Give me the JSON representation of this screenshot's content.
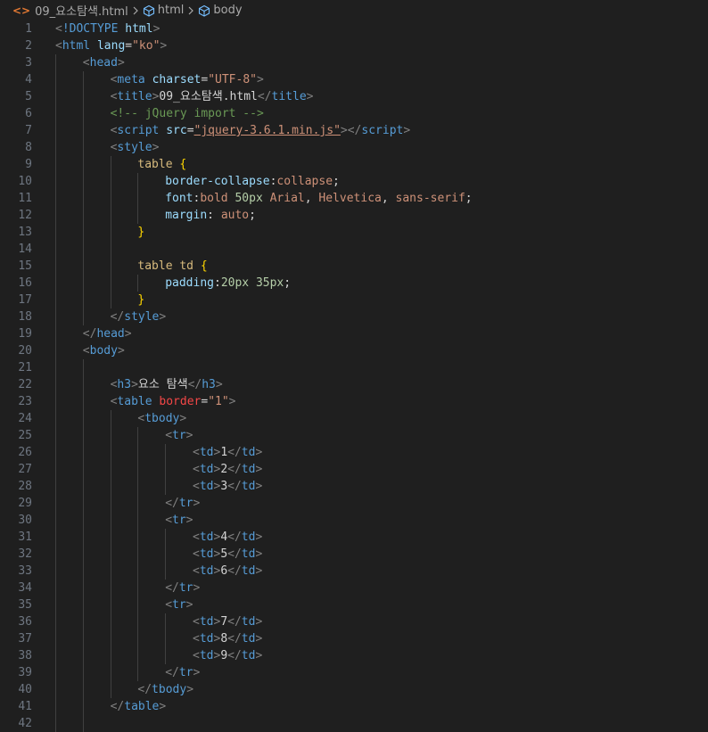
{
  "breadcrumb": {
    "file_icon": "html-file-icon",
    "file": "09_요소탐색.html",
    "items": [
      "html",
      "body"
    ]
  },
  "lines": [
    {
      "n": "1",
      "indent": 0,
      "tokens": [
        [
          "bracket",
          "<"
        ],
        [
          "doctype",
          "!DOCTYPE"
        ],
        [
          "text",
          " "
        ],
        [
          "attr",
          "html"
        ],
        [
          "bracket",
          ">"
        ]
      ]
    },
    {
      "n": "2",
      "indent": 0,
      "tokens": [
        [
          "bracket",
          "<"
        ],
        [
          "tag",
          "html"
        ],
        [
          "text",
          " "
        ],
        [
          "attr",
          "lang"
        ],
        [
          "punct",
          "="
        ],
        [
          "str",
          "\"ko\""
        ],
        [
          "bracket",
          ">"
        ]
      ]
    },
    {
      "n": "3",
      "indent": 1,
      "tokens": [
        [
          "bracket",
          "<"
        ],
        [
          "tag",
          "head"
        ],
        [
          "bracket",
          ">"
        ]
      ]
    },
    {
      "n": "4",
      "indent": 2,
      "tokens": [
        [
          "bracket",
          "<"
        ],
        [
          "tag",
          "meta"
        ],
        [
          "text",
          " "
        ],
        [
          "attr",
          "charset"
        ],
        [
          "punct",
          "="
        ],
        [
          "str",
          "\"UTF-8\""
        ],
        [
          "bracket",
          ">"
        ]
      ]
    },
    {
      "n": "5",
      "indent": 2,
      "tokens": [
        [
          "bracket",
          "<"
        ],
        [
          "tag",
          "title"
        ],
        [
          "bracket",
          ">"
        ],
        [
          "text",
          "09_요소탐색.html"
        ],
        [
          "bracket",
          "</"
        ],
        [
          "tag",
          "title"
        ],
        [
          "bracket",
          ">"
        ]
      ]
    },
    {
      "n": "6",
      "indent": 2,
      "tokens": [
        [
          "comment",
          "<!-- jQuery import -->"
        ]
      ]
    },
    {
      "n": "7",
      "indent": 2,
      "tokens": [
        [
          "bracket",
          "<"
        ],
        [
          "tag",
          "script"
        ],
        [
          "text",
          " "
        ],
        [
          "attr",
          "src"
        ],
        [
          "punct",
          "="
        ],
        [
          "strlink",
          "\"jquery-3.6.1.min.js\""
        ],
        [
          "bracket",
          "></"
        ],
        [
          "tag",
          "script"
        ],
        [
          "bracket",
          ">"
        ]
      ]
    },
    {
      "n": "8",
      "indent": 2,
      "tokens": [
        [
          "bracket",
          "<"
        ],
        [
          "tag",
          "style"
        ],
        [
          "bracket",
          ">"
        ]
      ]
    },
    {
      "n": "9",
      "indent": 3,
      "tokens": [
        [
          "selector",
          "table"
        ],
        [
          "text",
          " "
        ],
        [
          "brace",
          "{"
        ]
      ]
    },
    {
      "n": "10",
      "indent": 4,
      "tokens": [
        [
          "prop",
          "border-collapse"
        ],
        [
          "punct",
          ":"
        ],
        [
          "value",
          "collapse"
        ],
        [
          "punct",
          ";"
        ]
      ]
    },
    {
      "n": "11",
      "indent": 4,
      "tokens": [
        [
          "prop",
          "font"
        ],
        [
          "punct",
          ":"
        ],
        [
          "value",
          "bold "
        ],
        [
          "num",
          "50px"
        ],
        [
          "value",
          " Arial"
        ],
        [
          "punct",
          ", "
        ],
        [
          "value",
          "Helvetica"
        ],
        [
          "punct",
          ", "
        ],
        [
          "value",
          "sans-serif"
        ],
        [
          "punct",
          ";"
        ]
      ]
    },
    {
      "n": "12",
      "indent": 4,
      "tokens": [
        [
          "prop",
          "margin"
        ],
        [
          "punct",
          ": "
        ],
        [
          "value",
          "auto"
        ],
        [
          "punct",
          ";"
        ]
      ]
    },
    {
      "n": "13",
      "indent": 3,
      "tokens": [
        [
          "brace",
          "}"
        ]
      ]
    },
    {
      "n": "14",
      "indent": 3,
      "tokens": []
    },
    {
      "n": "15",
      "indent": 3,
      "tokens": [
        [
          "selector",
          "table td"
        ],
        [
          "text",
          " "
        ],
        [
          "brace",
          "{"
        ]
      ]
    },
    {
      "n": "16",
      "indent": 4,
      "tokens": [
        [
          "prop",
          "padding"
        ],
        [
          "punct",
          ":"
        ],
        [
          "num",
          "20px"
        ],
        [
          "text",
          " "
        ],
        [
          "num",
          "35px"
        ],
        [
          "punct",
          ";"
        ]
      ]
    },
    {
      "n": "17",
      "indent": 3,
      "tokens": [
        [
          "brace",
          "}"
        ]
      ]
    },
    {
      "n": "18",
      "indent": 2,
      "tokens": [
        [
          "bracket",
          "</"
        ],
        [
          "tag",
          "style"
        ],
        [
          "bracket",
          ">"
        ]
      ]
    },
    {
      "n": "19",
      "indent": 1,
      "tokens": [
        [
          "bracket",
          "</"
        ],
        [
          "tag",
          "head"
        ],
        [
          "bracket",
          ">"
        ]
      ]
    },
    {
      "n": "20",
      "indent": 1,
      "tokens": [
        [
          "bracket",
          "<"
        ],
        [
          "tag",
          "body"
        ],
        [
          "bracket",
          ">"
        ]
      ]
    },
    {
      "n": "21",
      "indent": 2,
      "tokens": []
    },
    {
      "n": "22",
      "indent": 2,
      "tokens": [
        [
          "bracket",
          "<"
        ],
        [
          "tag",
          "h3"
        ],
        [
          "bracket",
          ">"
        ],
        [
          "text",
          "요소 탐색"
        ],
        [
          "bracket",
          "</"
        ],
        [
          "tag",
          "h3"
        ],
        [
          "bracket",
          ">"
        ]
      ]
    },
    {
      "n": "23",
      "indent": 2,
      "tokens": [
        [
          "bracket",
          "<"
        ],
        [
          "tag",
          "table"
        ],
        [
          "text",
          " "
        ],
        [
          "red",
          "border"
        ],
        [
          "punct",
          "="
        ],
        [
          "str",
          "\"1\""
        ],
        [
          "bracket",
          ">"
        ]
      ]
    },
    {
      "n": "24",
      "indent": 3,
      "tokens": [
        [
          "bracket",
          "<"
        ],
        [
          "tag",
          "tbody"
        ],
        [
          "bracket",
          ">"
        ]
      ]
    },
    {
      "n": "25",
      "indent": 4,
      "tokens": [
        [
          "bracket",
          "<"
        ],
        [
          "tag",
          "tr"
        ],
        [
          "bracket",
          ">"
        ]
      ]
    },
    {
      "n": "26",
      "indent": 5,
      "tokens": [
        [
          "bracket",
          "<"
        ],
        [
          "tag",
          "td"
        ],
        [
          "bracket",
          ">"
        ],
        [
          "text",
          "1"
        ],
        [
          "bracket",
          "</"
        ],
        [
          "tag",
          "td"
        ],
        [
          "bracket",
          ">"
        ]
      ]
    },
    {
      "n": "27",
      "indent": 5,
      "tokens": [
        [
          "bracket",
          "<"
        ],
        [
          "tag",
          "td"
        ],
        [
          "bracket",
          ">"
        ],
        [
          "text",
          "2"
        ],
        [
          "bracket",
          "</"
        ],
        [
          "tag",
          "td"
        ],
        [
          "bracket",
          ">"
        ]
      ]
    },
    {
      "n": "28",
      "indent": 5,
      "tokens": [
        [
          "bracket",
          "<"
        ],
        [
          "tag",
          "td"
        ],
        [
          "bracket",
          ">"
        ],
        [
          "text",
          "3"
        ],
        [
          "bracket",
          "</"
        ],
        [
          "tag",
          "td"
        ],
        [
          "bracket",
          ">"
        ]
      ]
    },
    {
      "n": "29",
      "indent": 4,
      "tokens": [
        [
          "bracket",
          "</"
        ],
        [
          "tag",
          "tr"
        ],
        [
          "bracket",
          ">"
        ]
      ]
    },
    {
      "n": "30",
      "indent": 4,
      "tokens": [
        [
          "bracket",
          "<"
        ],
        [
          "tag",
          "tr"
        ],
        [
          "bracket",
          ">"
        ]
      ]
    },
    {
      "n": "31",
      "indent": 5,
      "tokens": [
        [
          "bracket",
          "<"
        ],
        [
          "tag",
          "td"
        ],
        [
          "bracket",
          ">"
        ],
        [
          "text",
          "4"
        ],
        [
          "bracket",
          "</"
        ],
        [
          "tag",
          "td"
        ],
        [
          "bracket",
          ">"
        ]
      ]
    },
    {
      "n": "32",
      "indent": 5,
      "tokens": [
        [
          "bracket",
          "<"
        ],
        [
          "tag",
          "td"
        ],
        [
          "bracket",
          ">"
        ],
        [
          "text",
          "5"
        ],
        [
          "bracket",
          "</"
        ],
        [
          "tag",
          "td"
        ],
        [
          "bracket",
          ">"
        ]
      ]
    },
    {
      "n": "33",
      "indent": 5,
      "tokens": [
        [
          "bracket",
          "<"
        ],
        [
          "tag",
          "td"
        ],
        [
          "bracket",
          ">"
        ],
        [
          "text",
          "6"
        ],
        [
          "bracket",
          "</"
        ],
        [
          "tag",
          "td"
        ],
        [
          "bracket",
          ">"
        ]
      ]
    },
    {
      "n": "34",
      "indent": 4,
      "tokens": [
        [
          "bracket",
          "</"
        ],
        [
          "tag",
          "tr"
        ],
        [
          "bracket",
          ">"
        ]
      ]
    },
    {
      "n": "35",
      "indent": 4,
      "tokens": [
        [
          "bracket",
          "<"
        ],
        [
          "tag",
          "tr"
        ],
        [
          "bracket",
          ">"
        ]
      ]
    },
    {
      "n": "36",
      "indent": 5,
      "tokens": [
        [
          "bracket",
          "<"
        ],
        [
          "tag",
          "td"
        ],
        [
          "bracket",
          ">"
        ],
        [
          "text",
          "7"
        ],
        [
          "bracket",
          "</"
        ],
        [
          "tag",
          "td"
        ],
        [
          "bracket",
          ">"
        ]
      ]
    },
    {
      "n": "37",
      "indent": 5,
      "tokens": [
        [
          "bracket",
          "<"
        ],
        [
          "tag",
          "td"
        ],
        [
          "bracket",
          ">"
        ],
        [
          "text",
          "8"
        ],
        [
          "bracket",
          "</"
        ],
        [
          "tag",
          "td"
        ],
        [
          "bracket",
          ">"
        ]
      ]
    },
    {
      "n": "38",
      "indent": 5,
      "tokens": [
        [
          "bracket",
          "<"
        ],
        [
          "tag",
          "td"
        ],
        [
          "bracket",
          ">"
        ],
        [
          "text",
          "9"
        ],
        [
          "bracket",
          "</"
        ],
        [
          "tag",
          "td"
        ],
        [
          "bracket",
          ">"
        ]
      ]
    },
    {
      "n": "39",
      "indent": 4,
      "tokens": [
        [
          "bracket",
          "</"
        ],
        [
          "tag",
          "tr"
        ],
        [
          "bracket",
          ">"
        ]
      ]
    },
    {
      "n": "40",
      "indent": 3,
      "tokens": [
        [
          "bracket",
          "</"
        ],
        [
          "tag",
          "tbody"
        ],
        [
          "bracket",
          ">"
        ]
      ]
    },
    {
      "n": "41",
      "indent": 2,
      "tokens": [
        [
          "bracket",
          "</"
        ],
        [
          "tag",
          "table"
        ],
        [
          "bracket",
          ">"
        ]
      ]
    },
    {
      "n": "42",
      "indent": 2,
      "tokens": []
    }
  ]
}
